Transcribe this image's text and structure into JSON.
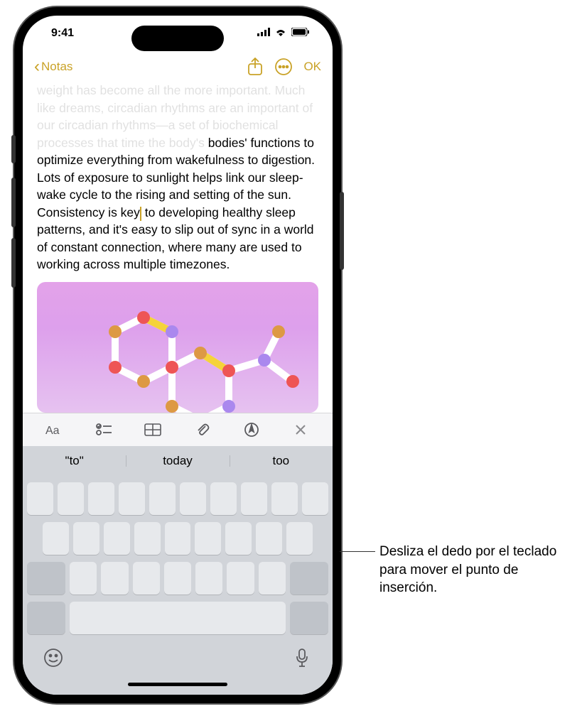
{
  "status": {
    "time": "9:41"
  },
  "nav": {
    "back_label": "Notas",
    "done_label": "OK"
  },
  "note": {
    "ghost_lines": "weight has become all the more important. Much like dreams, circadian rhythms are an important of our circadian rhythms—a set of biochemical processes that time the body's",
    "body_before_cursor": "bodies' functions to optimize everything from wakefulness to digestion. Lots of exposure to sunlight helps link our sleep-wake cycle to the rising and setting of the sun. Consistency is key",
    "body_after_cursor": "to developing healthy sleep patterns, and it's easy to slip out of sync in a world of constant connection, where many are used to working across multiple timezones."
  },
  "suggestions": [
    "\"to\"",
    "today",
    "too"
  ],
  "callout": "Desliza el dedo por el teclado para mover el punto de inserción.",
  "colors": {
    "accent": "#c9a227"
  }
}
